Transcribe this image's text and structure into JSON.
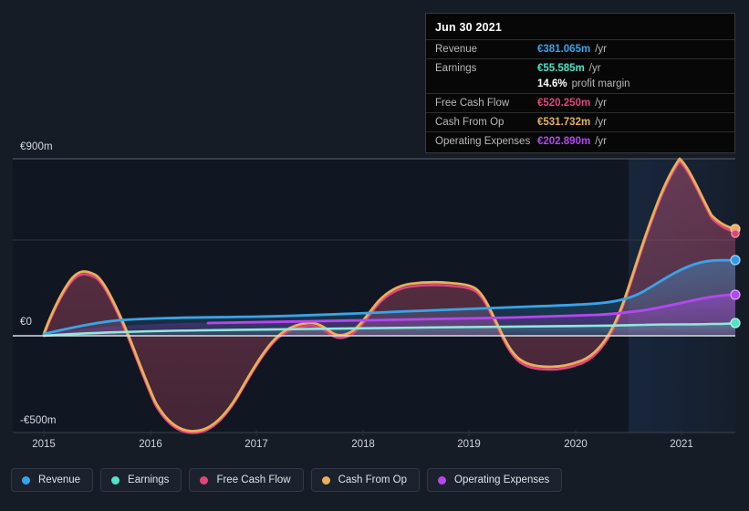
{
  "background": "#151c26",
  "series_colors": {
    "revenue": "#3aa3e8",
    "earnings": "#4fe3c8",
    "free_cash_flow": "#e0467c",
    "cash_from_op": "#e9b05a",
    "operating_expenses": "#b447f0"
  },
  "tooltip": {
    "title": "Jun 30 2021",
    "rows": [
      {
        "name": "Revenue",
        "value": "€381.065m",
        "unit": "/yr",
        "color": "#3aa3e8"
      },
      {
        "name": "Earnings",
        "value": "€55.585m",
        "unit": "/yr",
        "color": "#4fe3c8"
      },
      {
        "name": "",
        "value": "14.6%",
        "unit": "profit margin",
        "color": "#ffffff",
        "sub": true
      },
      {
        "name": "Free Cash Flow",
        "value": "€520.250m",
        "unit": "/yr",
        "color": "#e0467c"
      },
      {
        "name": "Cash From Op",
        "value": "€531.732m",
        "unit": "/yr",
        "color": "#e9b05a"
      },
      {
        "name": "Operating Expenses",
        "value": "€202.890m",
        "unit": "/yr",
        "color": "#b447f0"
      }
    ]
  },
  "legend": {
    "items": [
      {
        "label": "Revenue",
        "color": "#3aa3e8"
      },
      {
        "label": "Earnings",
        "color": "#4fe3c8"
      },
      {
        "label": "Free Cash Flow",
        "color": "#e0467c"
      },
      {
        "label": "Cash From Op",
        "color": "#e9b05a"
      },
      {
        "label": "Operating Expenses",
        "color": "#b447f0"
      }
    ]
  },
  "chart_data": {
    "type": "area",
    "title": "",
    "xlabel": "",
    "ylabel": "",
    "currency": "EUR",
    "unit": "m",
    "grid": true,
    "legend_position": "bottom",
    "ylim": [
      -500,
      900
    ],
    "y_ticks": [
      {
        "label": "€900m",
        "value": 900
      },
      {
        "label": "€0",
        "value": 0
      },
      {
        "label": "-€500m",
        "value": -500
      }
    ],
    "x_ticks": [
      "2015",
      "2016",
      "2017",
      "2018",
      "2019",
      "2020",
      "2021"
    ],
    "xlim": [
      "2014.85",
      "2021.45"
    ],
    "forecast_region_start": "2020.5",
    "highlighted_date": "Jun 30 2021",
    "x": [
      2015.0,
      2015.25,
      2015.5,
      2015.75,
      2016.0,
      2016.25,
      2016.5,
      2016.75,
      2017.0,
      2017.25,
      2017.5,
      2017.75,
      2018.0,
      2018.25,
      2018.5,
      2018.75,
      2019.0,
      2019.25,
      2019.5,
      2019.75,
      2020.0,
      2020.25,
      2020.5,
      2020.75,
      2021.0,
      2021.25,
      2021.45
    ],
    "series": [
      {
        "name": "Revenue",
        "color": "#3aa3e8",
        "values": [
          8,
          20,
          32,
          42,
          50,
          55,
          58,
          60,
          62,
          64,
          66,
          68,
          70,
          74,
          78,
          82,
          86,
          88,
          90,
          92,
          94,
          98,
          110,
          170,
          260,
          340,
          381
        ]
      },
      {
        "name": "Earnings",
        "color": "#4fe3c8",
        "values": [
          2,
          4,
          7,
          9,
          10,
          11,
          12,
          12,
          13,
          13,
          14,
          14,
          15,
          16,
          16,
          17,
          18,
          18,
          19,
          19,
          20,
          22,
          26,
          34,
          44,
          52,
          56
        ]
      },
      {
        "name": "Free Cash Flow",
        "color": "#e0467c",
        "values": [
          5,
          110,
          190,
          80,
          -70,
          -330,
          -495,
          -430,
          -300,
          -130,
          10,
          28,
          -10,
          60,
          175,
          235,
          255,
          250,
          150,
          -40,
          -135,
          -160,
          -130,
          250,
          720,
          900,
          520
        ]
      },
      {
        "name": "Cash From Op",
        "color": "#e9b05a",
        "values": [
          10,
          115,
          192,
          85,
          -65,
          -325,
          -493,
          -428,
          -298,
          -128,
          18,
          32,
          -5,
          65,
          180,
          240,
          258,
          253,
          155,
          -35,
          -128,
          -152,
          -122,
          258,
          728,
          905,
          532
        ]
      },
      {
        "name": "Operating Expenses",
        "color": "#b447f0",
        "values": [
          6,
          12,
          18,
          22,
          25,
          27,
          29,
          30,
          31,
          32,
          33,
          34,
          35,
          36,
          37,
          38,
          39,
          40,
          41,
          42,
          43,
          46,
          52,
          78,
          120,
          170,
          203
        ]
      }
    ]
  }
}
